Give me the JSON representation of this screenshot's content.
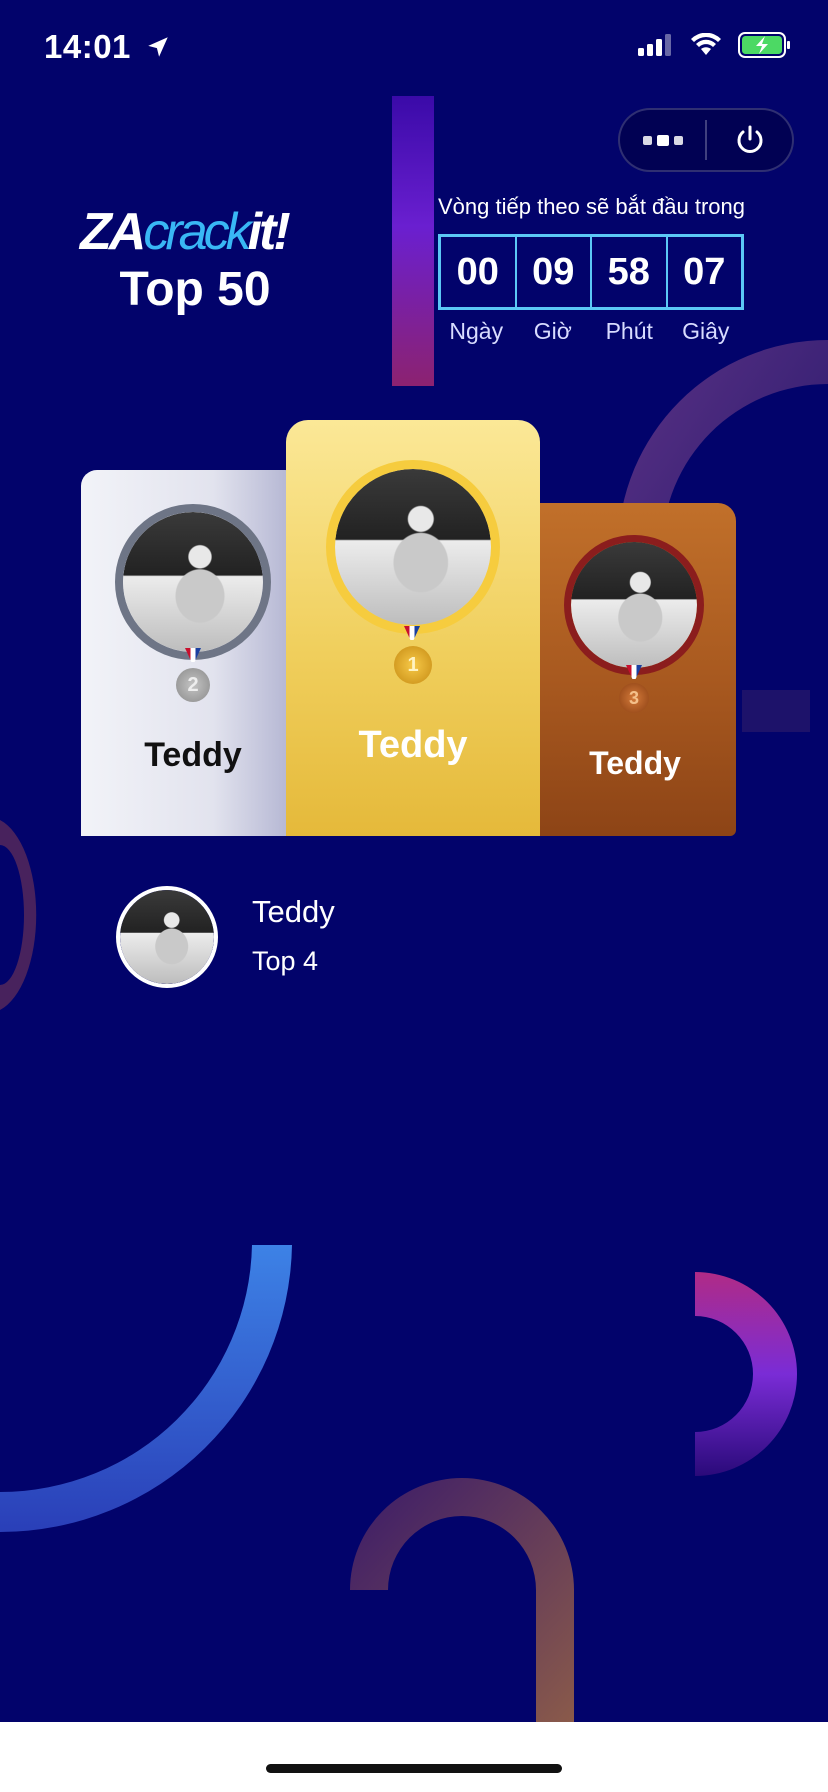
{
  "status_bar": {
    "time": "14:01",
    "icons": [
      "location-arrow-icon",
      "signal-icon",
      "wifi-icon",
      "battery-charging-icon"
    ]
  },
  "capsule": {
    "more_icon": "three-dots-icon",
    "power_icon": "power-icon"
  },
  "brand": {
    "logo_za": "ZA",
    "logo_crack": "crack",
    "logo_it": "it!",
    "subtitle": "Top 50"
  },
  "countdown": {
    "title": "Vòng tiếp theo sẽ bắt đầu trong",
    "values": [
      "00",
      "09",
      "58",
      "07"
    ],
    "labels": [
      "Ngày",
      "Giờ",
      "Phút",
      "Giây"
    ]
  },
  "podium": [
    {
      "rank": "2",
      "name": "Teddy"
    },
    {
      "rank": "1",
      "name": "Teddy"
    },
    {
      "rank": "3",
      "name": "Teddy"
    }
  ],
  "list": [
    {
      "name": "Teddy",
      "rank_label": "Top 4"
    }
  ],
  "colors": {
    "background": "#02036b",
    "accent": "#5cc8f5",
    "gold": "#f0cf5d",
    "silver": "#e2e3ee",
    "bronze": "#a7581f"
  }
}
